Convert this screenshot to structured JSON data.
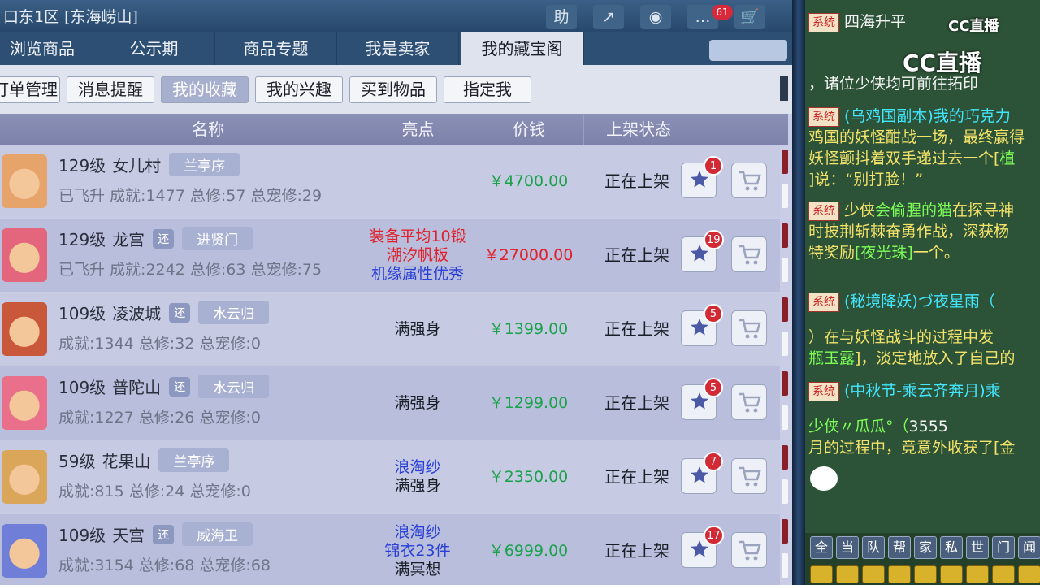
{
  "window": {
    "title": "口东1区 [东海崂山]",
    "help_label": "助",
    "mail_count": "61"
  },
  "tabs": [
    {
      "label": "浏览商品"
    },
    {
      "label": "公示期"
    },
    {
      "label": "商品专题"
    },
    {
      "label": "我是卖家"
    },
    {
      "label": "我的藏宝阁",
      "active": true
    }
  ],
  "subtabs": [
    {
      "label": "订单管理"
    },
    {
      "label": "消息提醒"
    },
    {
      "label": "我的收藏",
      "active": true
    },
    {
      "label": "我的兴趣"
    },
    {
      "label": "买到物品"
    },
    {
      "label": "指定我"
    }
  ],
  "columns": {
    "name": "名称",
    "highlight": "亮点",
    "price": "价钱",
    "status": "上架状态"
  },
  "rows": [
    {
      "level": "129级",
      "school": "女儿村",
      "huan": "",
      "tag": "兰亭序",
      "stats": "已飞升  成就:1477  总修:57  总宠修:29",
      "highlights": [],
      "price": "￥4700.00",
      "price_color": "#1aa24a",
      "status": "正在上架",
      "fav_count": "1"
    },
    {
      "level": "129级",
      "school": "龙宫",
      "huan": "还",
      "tag": "进贤门",
      "stats": "已飞升  成就:2242  总修:63  总宠修:75",
      "highlights": [
        {
          "text": "装备平均10锻",
          "color": "#e0202a"
        },
        {
          "text": "潮汐帆板",
          "color": "#e0202a"
        },
        {
          "text": "机缘属性优秀",
          "color": "#2a3fd6"
        }
      ],
      "price": "￥27000.00",
      "price_color": "#e0202a",
      "status": "正在上架",
      "fav_count": "19"
    },
    {
      "level": "109级",
      "school": "凌波城",
      "huan": "还",
      "tag": "水云归",
      "stats": "成就:1344  总修:32  总宠修:0",
      "highlights": [
        {
          "text": "满强身",
          "color": "#1b1f28"
        }
      ],
      "price": "￥1399.00",
      "price_color": "#1aa24a",
      "status": "正在上架",
      "fav_count": "5"
    },
    {
      "level": "109级",
      "school": "普陀山",
      "huan": "还",
      "tag": "水云归",
      "stats": "成就:1227  总修:26  总宠修:0",
      "highlights": [
        {
          "text": "满强身",
          "color": "#1b1f28"
        }
      ],
      "price": "￥1299.00",
      "price_color": "#1aa24a",
      "status": "正在上架",
      "fav_count": "5"
    },
    {
      "level": "59级",
      "school": "花果山",
      "huan": "",
      "tag": "兰亭序",
      "stats": "成就:815  总修:24  总宠修:0",
      "highlights": [
        {
          "text": "浪淘纱",
          "color": "#2a3fd6"
        },
        {
          "text": "满强身",
          "color": "#1b1f28"
        }
      ],
      "price": "￥2350.00",
      "price_color": "#1aa24a",
      "status": "正在上架",
      "fav_count": "7"
    },
    {
      "level": "109级",
      "school": "天宫",
      "huan": "还",
      "tag": "威海卫",
      "stats": "成就:3154  总修:68  总宠修:68",
      "highlights": [
        {
          "text": "浪淘纱",
          "color": "#2a3fd6"
        },
        {
          "text": "锦衣23件",
          "color": "#2a3fd6"
        },
        {
          "text": "满冥想",
          "color": "#1b1f28"
        }
      ],
      "price": "￥6999.00",
      "price_color": "#1aa24a",
      "status": "正在上架",
      "fav_count": "17"
    }
  ],
  "chat": {
    "brand": "CC直播",
    "sys_label": "系统",
    "messages": [
      {
        "parts": [
          {
            "t": "四海升平",
            "c": "white"
          }
        ]
      },
      {
        "parts": [
          {
            "t": "，诸位少侠均可前往拓印",
            "c": "white"
          }
        ]
      },
      {
        "parts": [
          {
            "t": "(乌鸡国副本)我的巧克力",
            "c": "cyan"
          }
        ]
      },
      {
        "parts": [
          {
            "t": "鸡国的妖怪酣战一场，最终赢得",
            "c": "yellow"
          }
        ]
      },
      {
        "parts": [
          {
            "t": "妖怪颤抖着双手递过去一个[",
            "c": "yellow"
          },
          {
            "t": "植",
            "c": "lgreen"
          }
        ]
      },
      {
        "parts": [
          {
            "t": "]说：“别打脸！”",
            "c": "yellow"
          }
        ]
      },
      {
        "parts": [
          {
            "t": "少侠",
            "c": "yellow"
          },
          {
            "t": "会偷腥的猫",
            "c": "lgreen"
          },
          {
            "t": "在探寻神",
            "c": "yellow"
          }
        ]
      },
      {
        "parts": [
          {
            "t": "时披荆斩棘奋勇作战，深获杨",
            "c": "yellow"
          }
        ]
      },
      {
        "parts": [
          {
            "t": "特奖励",
            "c": "yellow"
          },
          {
            "t": "[夜光珠]",
            "c": "lgreen"
          },
          {
            "t": "一个。",
            "c": "yellow"
          }
        ]
      },
      {
        "parts": [
          {
            "t": "(秘境降妖)づ夜星雨（",
            "c": "cyan"
          }
        ]
      },
      {
        "parts": [
          {
            "t": "）在与妖怪战斗的过程中发",
            "c": "yellow"
          }
        ]
      },
      {
        "parts": [
          {
            "t": "瓶玉露",
            "c": "lgreen"
          },
          {
            "t": "]，淡定地放入了自己的",
            "c": "yellow"
          }
        ]
      },
      {
        "parts": [
          {
            "t": "(中秋节-乘云齐奔月)乘",
            "c": "cyan"
          }
        ]
      },
      {
        "parts": [
          {
            "t": "少侠〃瓜瓜°（",
            "c": "lgreen"
          },
          {
            "t": "3555",
            "c": "white"
          }
        ]
      },
      {
        "parts": [
          {
            "t": "月的过程中，竟意外收获了[金",
            "c": "yellow"
          }
        ]
      }
    ],
    "channels": [
      "全",
      "当",
      "队",
      "帮",
      "家",
      "私",
      "世",
      "门",
      "闻"
    ]
  }
}
